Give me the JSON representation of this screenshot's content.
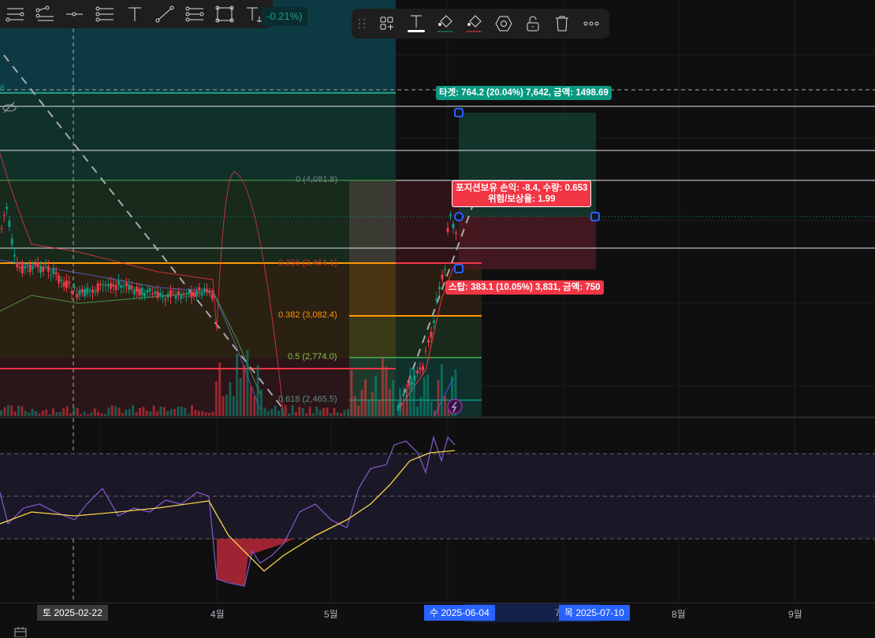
{
  "toolbar_left": {
    "tools": [
      "horizontal-ray-icon",
      "parallel-lines-icon",
      "horizontal-line-icon",
      "fib-retracement-icon",
      "text-icon",
      "trend-line-icon",
      "fib-levels-icon",
      "rectangle-icon",
      "anchored-text-icon"
    ],
    "price_change": "-0.21%)"
  },
  "floating_toolbar": {
    "tools": [
      "drag-handle-icon",
      "object-tree-icon",
      "text-style-icon",
      "fill-color-green-icon",
      "fill-color-red-icon",
      "settings-icon",
      "unlock-icon",
      "trash-icon",
      "more-icon"
    ]
  },
  "left_price_fragment": "6",
  "position": {
    "target_label": "타겟: 764.2 (20.04%) 7,642, 금액: 1498.69",
    "pnl_label_line1": "포지션보유 손익: -8.4, 수량: 0.653",
    "pnl_label_line2": "위험/보상율: 1.99",
    "stop_label": "스탑: 383.1 (10.05%) 3,831, 금액: 750"
  },
  "fib_levels": [
    {
      "label": "0 (4,081.8)",
      "color": "#787b86"
    },
    {
      "label": "0.236 (3,464.1)",
      "color": "#f23645"
    },
    {
      "label": "0.382 (3,082.4)",
      "color": "#ff9800"
    },
    {
      "label": "0.5 (2,774.0)",
      "color": "#4caf50"
    },
    {
      "label": "0.618 (2,465.5)",
      "color": "#089981"
    }
  ],
  "time_axis": {
    "cursor_date": "토 2025-02-22",
    "ticks": [
      "4월",
      "5월",
      "7",
      "8월",
      "9월"
    ],
    "range_start": "수 2025-06-04",
    "range_end": "목 2025-07-10"
  },
  "colors": {
    "accent": "#2962ff",
    "up": "#089981",
    "down": "#f23645",
    "target": "#089981",
    "stop": "#f23645"
  }
}
